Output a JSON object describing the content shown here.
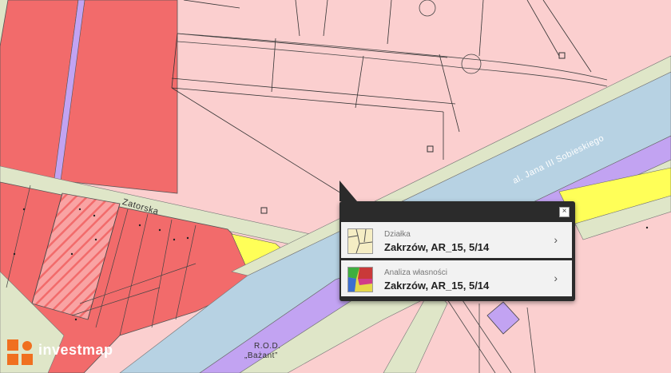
{
  "streets": {
    "zatorska": "Zatorska",
    "sobieskiego": "al. Jana III Sobieskiego",
    "rod_line1": "R.O.D.",
    "rod_line2": "„Bażant”"
  },
  "popup": {
    "close_label": "×",
    "items": [
      {
        "type_label": "Działka",
        "value": "Zakrzów, AR_15, 5/14",
        "icon": "parcel-map-icon"
      },
      {
        "type_label": "Analiza własności",
        "value": "Zakrzów, AR_15, 5/14",
        "icon": "ownership-map-icon"
      }
    ]
  },
  "brand": {
    "name": "investmap"
  },
  "colors": {
    "residential": "#fbcfcf",
    "red_zone": "#f26b6b",
    "road": "#b7d2e3",
    "purple_strip": "#c2a3f2",
    "yellow_strip": "#ffff58",
    "green_strip": "#dfe6c8",
    "popup_bg": "#2b2b2b"
  }
}
